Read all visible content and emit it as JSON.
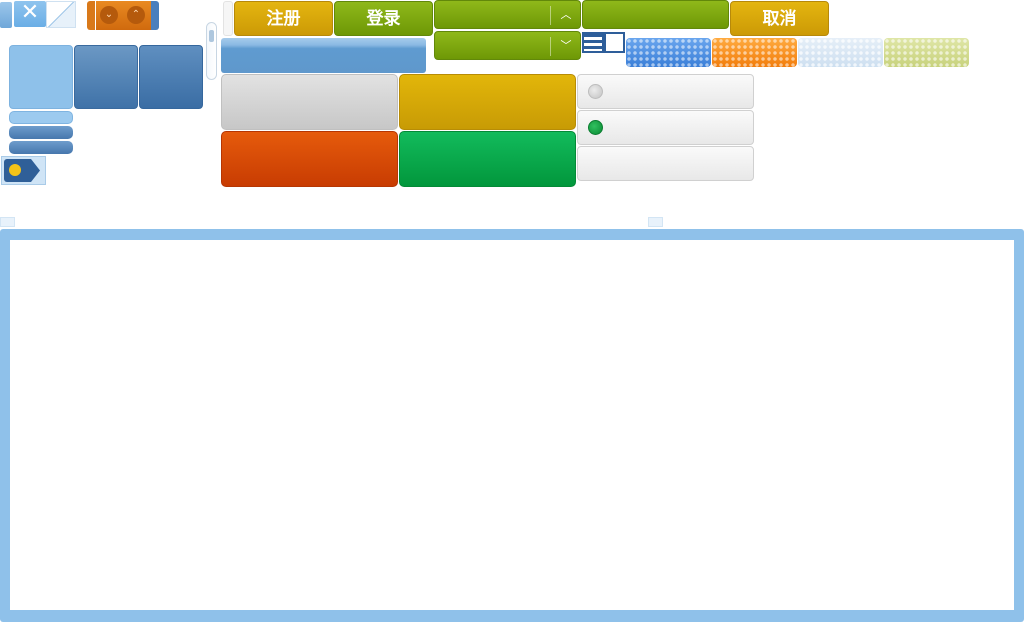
{
  "buttons": {
    "register": "注册",
    "login": "登录",
    "cancel": "取消"
  },
  "icons": {
    "close": "close-icon",
    "collapse": "chevron-down-icon",
    "expand": "chevron-up-icon",
    "bulb": "lightbulb-icon",
    "list_view": "list-view-icon",
    "single_view": "single-view-icon"
  },
  "radio_options": [
    {
      "state": "unselected"
    },
    {
      "state": "selected"
    },
    {
      "state": "none"
    }
  ],
  "colors": {
    "accent_blue": "#8fc1ea",
    "green": "#7fab10",
    "gold": "#d9a60b",
    "orange_red": "#d84c06",
    "bright_green": "#06a94b"
  }
}
